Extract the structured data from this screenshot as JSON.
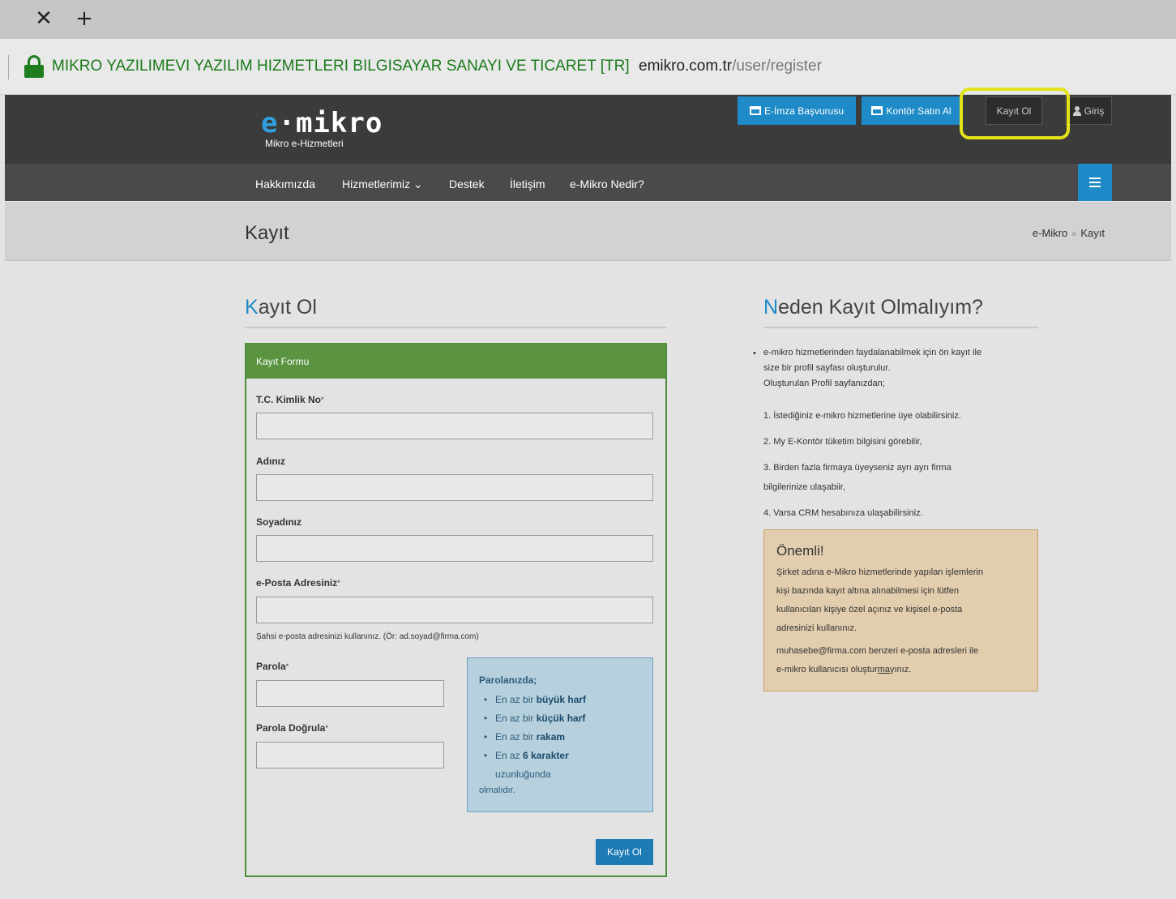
{
  "browser": {
    "close_tab_glyph": "✕",
    "new_tab_glyph": "+",
    "cert_owner": "MIKRO YAZILIMEVI YAZILIM HIZMETLERI BILGISAYAR SANAYI VE TICARET [TR]",
    "url_domain": "emikro.com.tr",
    "url_path": "/user/register"
  },
  "header": {
    "logo_e": "e",
    "logo_rest": "·mikro",
    "logo_sub": "Mikro e-Hizmetleri",
    "eimza_label": "E-İmza Başvurusu",
    "kontor_label": "Kontör Satın Al",
    "register_label": "Kayıt Ol",
    "login_label": "Giriş"
  },
  "nav": {
    "items": [
      "Hakkımızda",
      "Hizmetlerimiz ⌄",
      "Destek",
      "İletişim",
      "e-Mikro Nedir?"
    ]
  },
  "title_band": {
    "title": "Kayıt",
    "crumb_home": "e-Mikro",
    "crumb_sep": "»",
    "crumb_current": "Kayıt"
  },
  "form": {
    "section_title_first": "K",
    "section_title_rest": "ayıt Ol",
    "panel_title": "Kayıt Formu",
    "tc_label": "T.C. Kimlik No",
    "name_label": "Adınız",
    "surname_label": "Soyadınız",
    "email_label": "e-Posta Adresiniz",
    "email_help": "Şahsi e-posta adresinizi kullanınız. (Ör: ad.soyad@firma.com)",
    "password_label": "Parola",
    "password_confirm_label": "Parola Doğrula",
    "req_mark": "*",
    "tc_value": "",
    "name_value": "",
    "surname_value": "",
    "email_value": "",
    "password_value": "",
    "password_confirm_value": "",
    "submit_label": "Kayıt Ol",
    "rules": {
      "title": "Parolanızda;",
      "r1_pre": "En az bir ",
      "r1_bold": "büyük harf",
      "r2_pre": "En az bir ",
      "r2_bold": "küçük harf",
      "r3_pre": "En az bir ",
      "r3_bold": "rakam",
      "r4_pre": "En az ",
      "r4_bold": "6 karakter",
      "r4_post": "uzunluğunda",
      "footer": "olmalıdır."
    }
  },
  "why": {
    "title_first": "N",
    "title_rest": "eden Kayıt Olmalıyım?",
    "intro_1": "e-mikro hizmetlerinden faydalanabilmek için ön kayıt ile",
    "intro_2": "size bir profil sayfası oluşturulur.",
    "intro_3": "Oluşturulan Profil sayfanızdan;",
    "item_1": "1. İstediğiniz e-mikro hizmetlerine üye olabilirsiniz.",
    "item_2": "2. My E-Kontör tüketim bilgisini görebilir,",
    "item_3a": "3. Birden fazla firmaya üyeyseniz ayrı ayrı firma",
    "item_3b": "bilgilerinize ulaşabiir,",
    "item_4": "4. Varsa CRM hesabınıza ulaşabilirsiniz.",
    "important": {
      "title": "Önemli!",
      "line_1": "Şirket adına e-Mikro hizmetlerinde yapılan işlemlerin",
      "line_2": "kişi bazında kayıt altına alınabilmesi için lütfen",
      "line_3": "kullanıcıları kişiye özel açınız ve kişisel e-posta",
      "line_4": "adresinizi kullanınız.",
      "line_5": "muhasebe@firma.com benzeri e-posta adresleri ile",
      "line_6_pre": "e-mikro kullanıcısı oluştur",
      "line_6_u": "ma",
      "line_6_post": "yınız."
    }
  },
  "colors": {
    "accent_blue": "#1e8ac7",
    "form_green": "#5a9441",
    "highlight_yellow": "#e3e31a"
  }
}
